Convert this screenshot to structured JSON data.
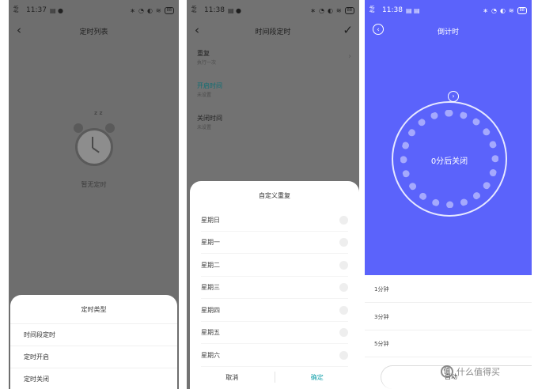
{
  "status_bars": {
    "p1": {
      "signal": "4G 4G",
      "time": "11:37"
    },
    "p2": {
      "signal": "4G 4G",
      "time": "11:38"
    },
    "p3": {
      "signal": "4G 4G",
      "time": "11:38"
    },
    "battery": "88"
  },
  "screen1": {
    "title": "定时列表",
    "zzz": "z z",
    "empty_text": "暂无定时",
    "sheet_title": "定时类型",
    "options": [
      "时间段定时",
      "定时开启",
      "定时关闭"
    ]
  },
  "screen2": {
    "title": "时间段定时",
    "settings": [
      {
        "label": "重复",
        "sub": "执行一次"
      },
      {
        "label": "开启时间",
        "sub": "未设置"
      },
      {
        "label": "关闭时间",
        "sub": "未设置"
      }
    ],
    "sheet_title": "自定义重复",
    "days": [
      "星期日",
      "星期一",
      "星期二",
      "星期三",
      "星期四",
      "星期五",
      "星期六"
    ],
    "cancel": "取消",
    "confirm": "确定"
  },
  "screen3": {
    "title": "倒计时",
    "remaining": "0分后关闭",
    "minutes": [
      "1分钟",
      "3分钟",
      "5分钟"
    ],
    "pill_label": "自动"
  },
  "watermark": {
    "logo": "值",
    "text": "什么值得买"
  },
  "colors": {
    "accent_blue": "#5b63fb",
    "confirm_teal": "#1aa3ad",
    "overlay_gray": "#6e6e6e"
  }
}
